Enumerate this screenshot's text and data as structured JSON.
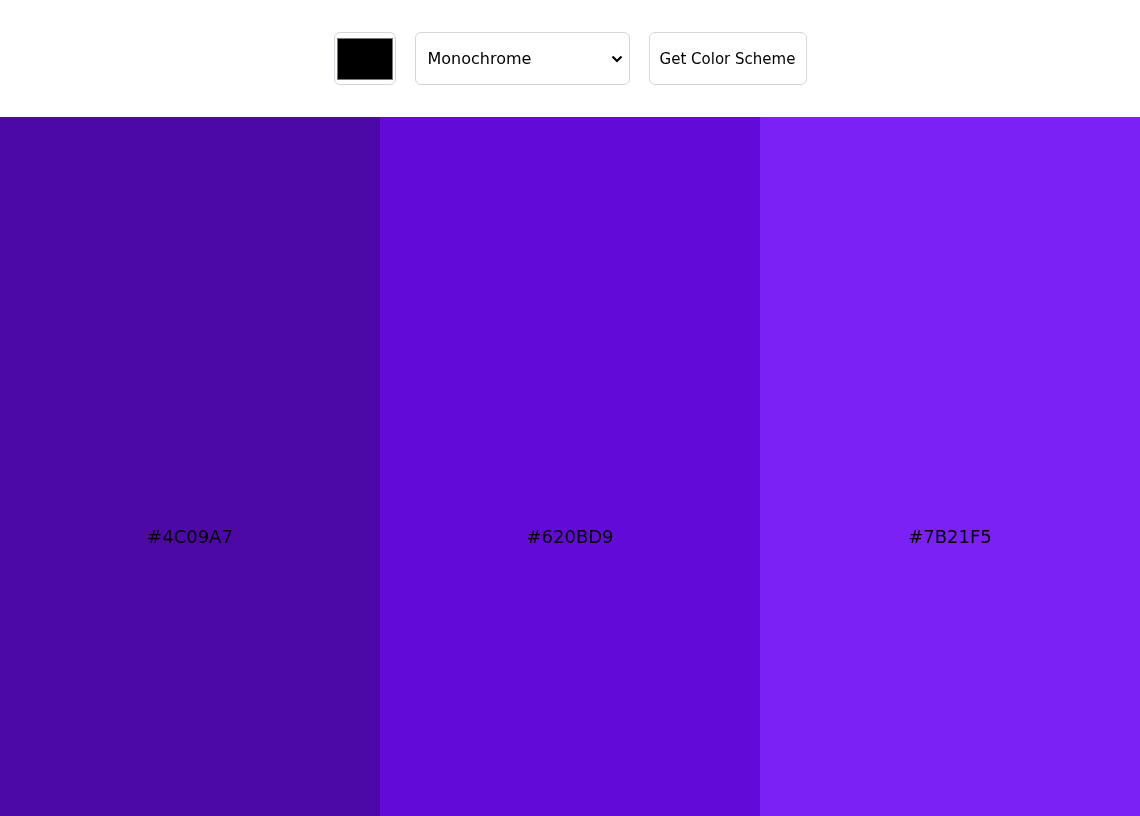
{
  "toolbar": {
    "seed_color": {
      "color": "#000000"
    },
    "scheme_select": {
      "value": "Monochrome"
    },
    "button": {
      "label": "Get Color Scheme"
    }
  },
  "palette": [
    {
      "color": "#4c09a7",
      "hex": "#4C09A7"
    },
    {
      "color": "#620bd9",
      "hex": "#620BD9"
    },
    {
      "color": "#7b21f5",
      "hex": "#7B21F5"
    }
  ]
}
